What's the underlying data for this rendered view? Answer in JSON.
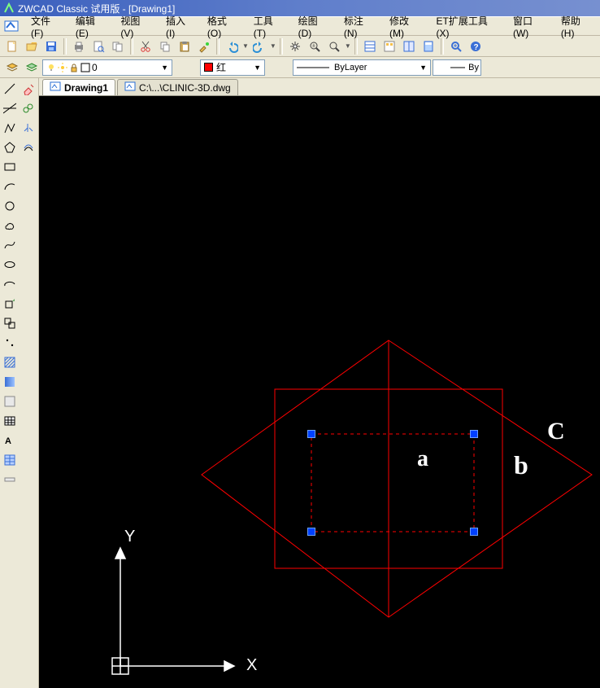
{
  "title": "ZWCAD Classic 试用版 - [Drawing1]",
  "menus": [
    "文件(F)",
    "编辑(E)",
    "视图(V)",
    "插入(I)",
    "格式(O)",
    "工具(T)",
    "绘图(D)",
    "标注(N)",
    "修改(M)",
    "ET扩展工具(X)",
    "窗口(W)",
    "帮助(H)"
  ],
  "layer": {
    "name": "0"
  },
  "color": {
    "name": "红"
  },
  "linetype": "ByLayer",
  "lineweight": "By",
  "tabs": [
    {
      "label": "Drawing1",
      "active": true
    },
    {
      "label": "C:\\...\\CLINIC-3D.dwg",
      "active": false
    }
  ],
  "annotations": {
    "a": "a",
    "b": "b",
    "c": "C",
    "x": "X",
    "y": "Y"
  },
  "icons": {
    "new": "new",
    "open": "open",
    "save": "save",
    "print": "print",
    "preview": "preview",
    "cut": "cut",
    "copy": "copy",
    "paste": "paste",
    "match": "match",
    "undo": "undo",
    "redo": "redo",
    "pan": "pan",
    "zoom": "zoom",
    "zoomwin": "zoomwin",
    "props": "props",
    "block": "block",
    "table": "table",
    "zoomext": "zoomext",
    "help": "help"
  }
}
